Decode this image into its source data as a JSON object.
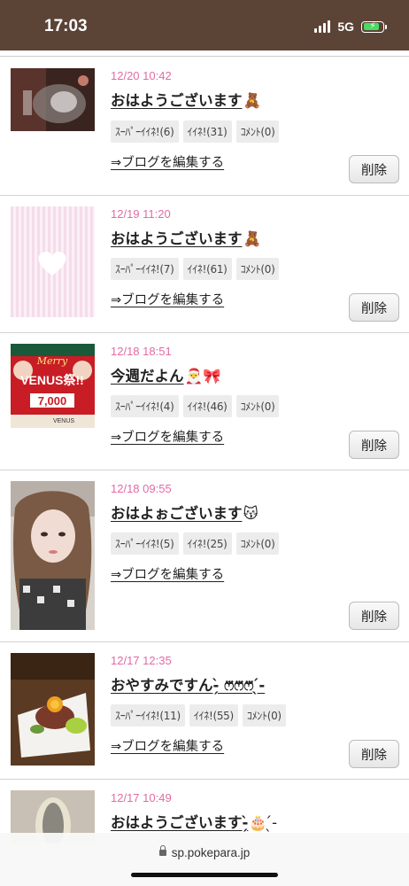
{
  "status_bar": {
    "time": "17:03",
    "network": "5G",
    "battery_icon": "battery-charging-icon"
  },
  "labels": {
    "edit_link": "⇒ブログを編集する",
    "delete_button": "削除"
  },
  "entries": [
    {
      "date": "12/20 10:42",
      "title": "おはようございます",
      "emoji": "🧸",
      "super_like": "ｽｰﾊﾟｰｲｲﾈ!(6)",
      "like": "ｲｲﾈ!(31)",
      "comment": "ｺﾒﾝﾄ(0)"
    },
    {
      "date": "12/19 11:20",
      "title": "おはようございます",
      "emoji": "🧸",
      "super_like": "ｽｰﾊﾟｰｲｲﾈ!(7)",
      "like": "ｲｲﾈ!(61)",
      "comment": "ｺﾒﾝﾄ(0)"
    },
    {
      "date": "12/18 18:51",
      "title": "今週だよん",
      "emoji": "🎅🎀",
      "super_like": "ｽｰﾊﾟｰｲｲﾈ!(4)",
      "like": "ｲｲﾈ!(46)",
      "comment": "ｺﾒﾝﾄ(0)",
      "thumb_text": {
        "line1": "Merry",
        "line2": "VENUS祭!!",
        "line3": "7,000",
        "line4": "VENUS"
      }
    },
    {
      "date": "12/18 09:55",
      "title": "おはよぉございます",
      "emoji": "😽",
      "super_like": "ｽｰﾊﾟｰｲｲﾈ!(5)",
      "like": "ｲｲﾈ!(25)",
      "comment": "ｺﾒﾝﾄ(0)"
    },
    {
      "date": "12/17 12:35",
      "title": "おやすみですん-̗̀ ෆ⃛ෆ⃛ෆ⃛ ̖́-",
      "emoji": "",
      "super_like": "ｽｰﾊﾟｰｲｲﾈ!(11)",
      "like": "ｲｲﾈ!(55)",
      "comment": "ｺﾒﾝﾄ(0)"
    },
    {
      "date": "12/17 10:49",
      "title": "おはようございます-̗̀",
      "emoji": "🎂 ̖́-"
    }
  ],
  "browser": {
    "url": "sp.pokepara.jp"
  },
  "colors": {
    "status_bar": "#5b4336",
    "date": "#e36aa4"
  }
}
